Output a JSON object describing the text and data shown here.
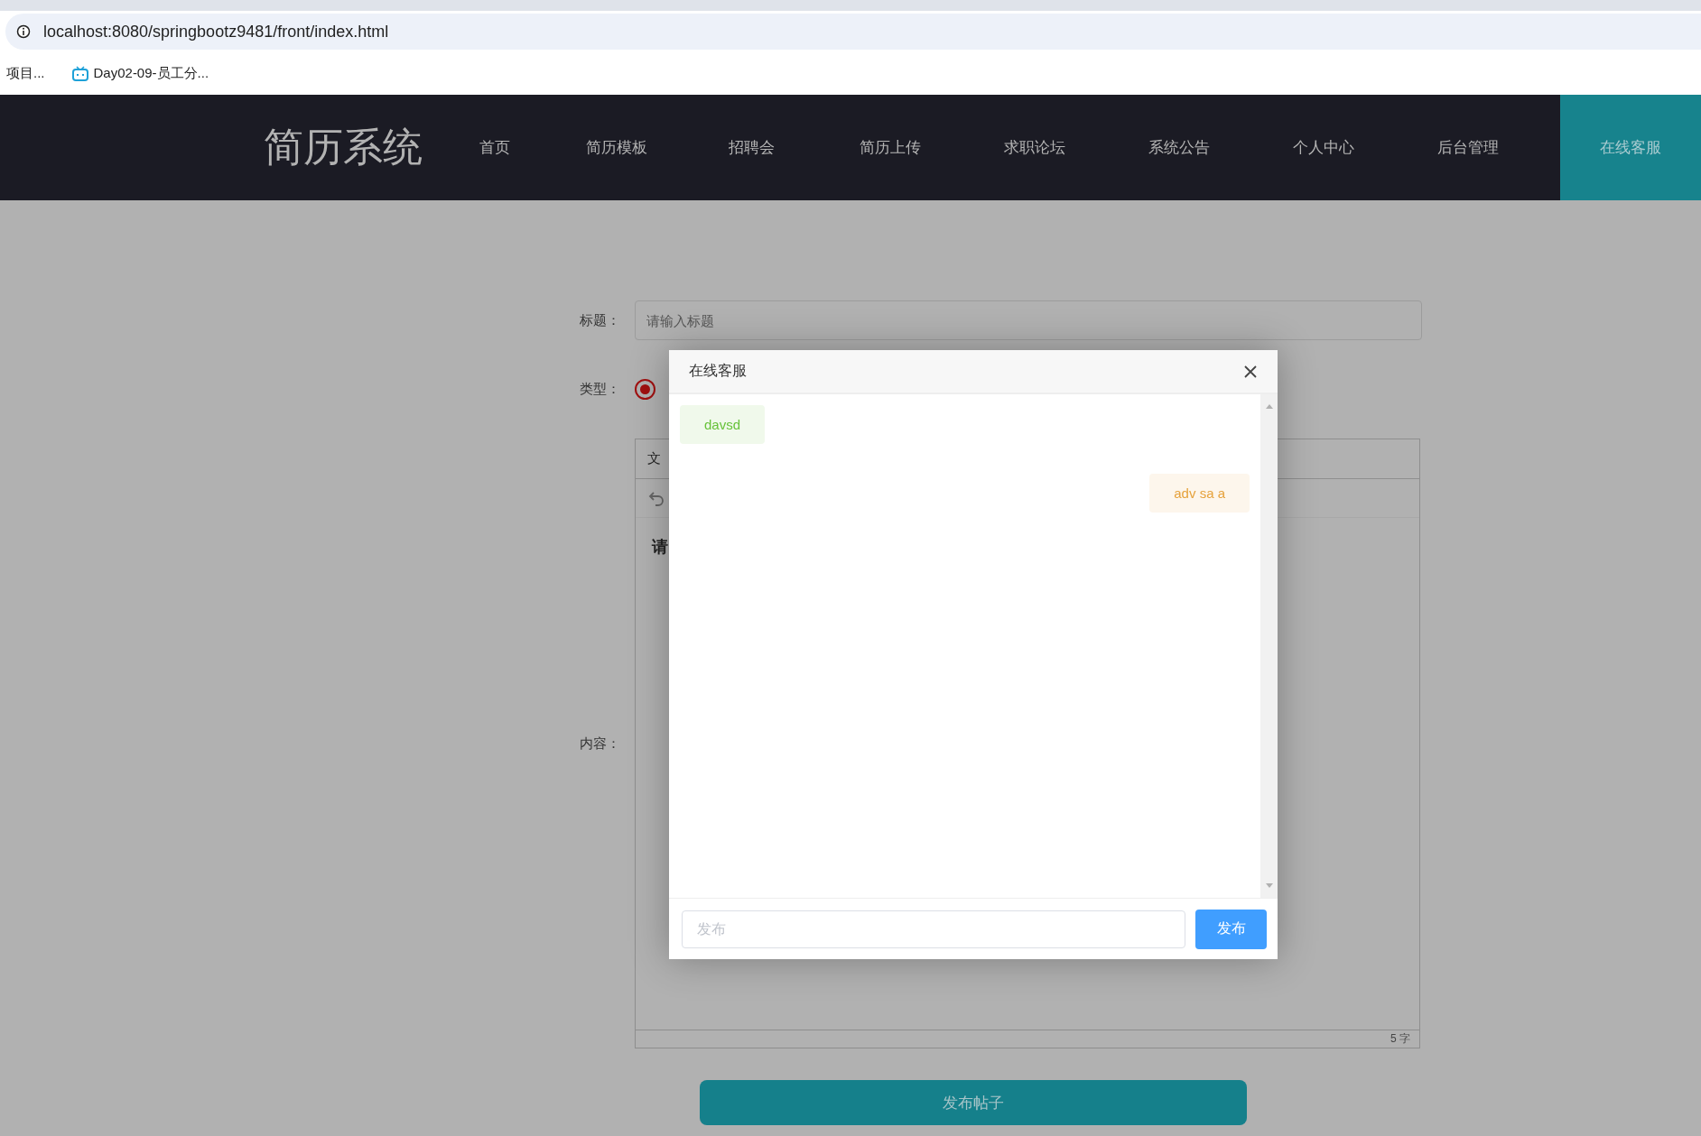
{
  "browser": {
    "url": "localhost:8080/springbootz9481/front/index.html",
    "bookmarks": [
      {
        "label": "项目...",
        "kind": "plain"
      },
      {
        "label": "Day02-09-员工分...",
        "kind": "tv"
      }
    ]
  },
  "nav": {
    "logo": "简历系统",
    "items": [
      {
        "label": "首页",
        "selected": false
      },
      {
        "label": "简历模板",
        "selected": false
      },
      {
        "label": "招聘会",
        "selected": false
      },
      {
        "label": "简历上传",
        "selected": false
      },
      {
        "label": "求职论坛",
        "selected": false
      },
      {
        "label": "系统公告",
        "selected": false
      },
      {
        "label": "个人中心",
        "selected": false
      },
      {
        "label": "后台管理",
        "selected": false
      },
      {
        "label": "在线客服",
        "selected": true
      }
    ]
  },
  "form": {
    "title_label": "标题：",
    "title_placeholder": "请输入标题",
    "type_label": "类型：",
    "type_radio": {
      "selected": true
    },
    "content_label": "内容：",
    "editor": {
      "menu": "文",
      "content": "请",
      "word_count": "5 字"
    },
    "submit": "发布帖子"
  },
  "chat_dialog": {
    "title": "在线客服",
    "messages": [
      {
        "text": "davsd",
        "kind": "received"
      },
      {
        "text": "adv sa a",
        "kind": "sent"
      }
    ],
    "input_placeholder": "发布",
    "send": "发布"
  }
}
